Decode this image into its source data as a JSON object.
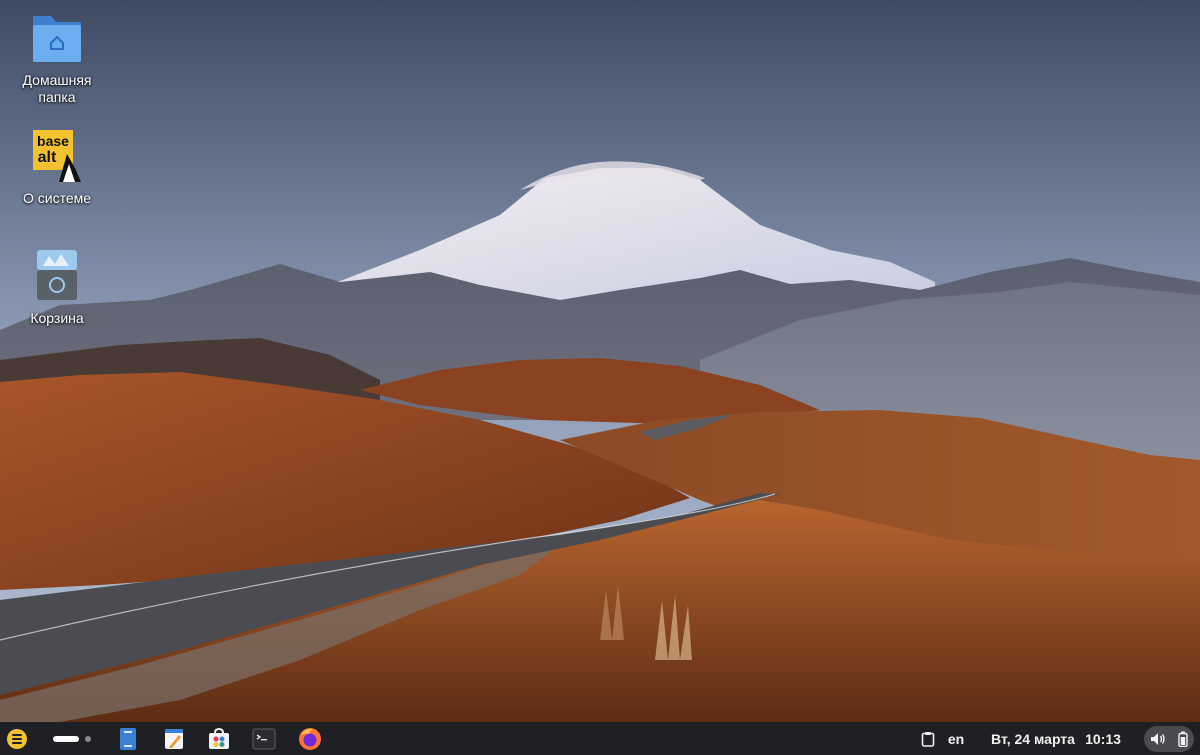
{
  "desktop": {
    "icons": [
      {
        "label": "Домашняя\nпапка",
        "icon": "home-folder-icon"
      },
      {
        "label": "О системе",
        "icon": "basealt-logo-icon",
        "logo_text": "base alt"
      },
      {
        "label": "Корзина",
        "icon": "trash-icon"
      }
    ]
  },
  "taskbar": {
    "menu_icon": "app-menu-icon",
    "workspaces": {
      "count": 2,
      "active": 1
    },
    "apps": [
      {
        "name": "file-manager-icon"
      },
      {
        "name": "text-editor-icon"
      },
      {
        "name": "app-store-icon"
      },
      {
        "name": "terminal-icon"
      },
      {
        "name": "firefox-icon"
      }
    ],
    "clipboard_icon": "clipboard-icon",
    "language": "en",
    "date": "Вт, 24 марта",
    "time": "10:13",
    "volume_icon": "volume-icon",
    "battery_icon": "battery-icon"
  },
  "colors": {
    "taskbar_bg": "#1f2023",
    "menu_accent": "#f2c230",
    "folder_blue": "#4a90d9",
    "firefox_orange": "#ff7139"
  }
}
